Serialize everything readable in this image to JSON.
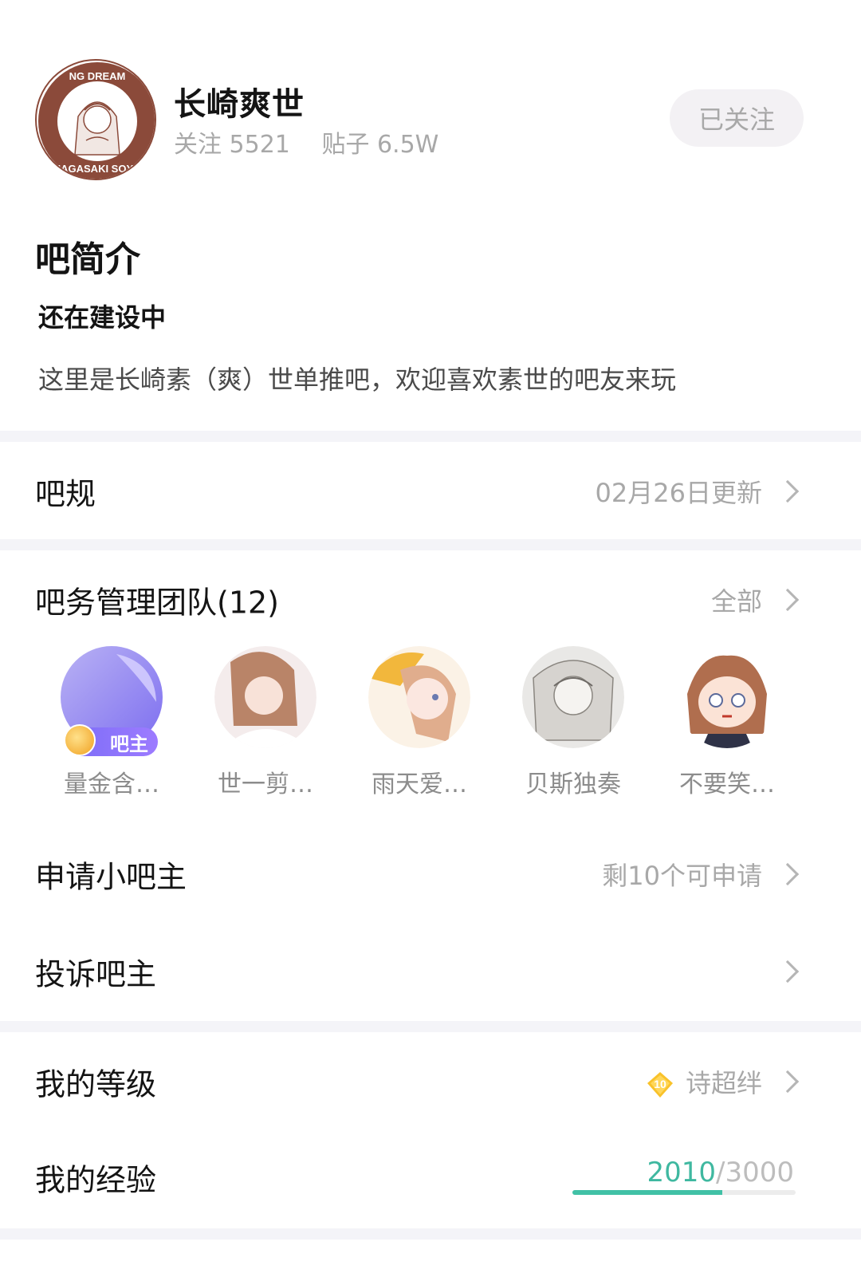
{
  "forum": {
    "name": "长崎爽世",
    "follow_count": "关注 5521",
    "post_count": "贴子 6.5W",
    "follow_button": "已关注",
    "avatar_text": "NAGASAKI SOYO · BANG DREAM"
  },
  "intro": {
    "title": "吧简介",
    "subtitle": "还在建设中",
    "text": "这里是长崎素（爽）世单推吧，欢迎喜欢素世的吧友来玩"
  },
  "rules": {
    "label": "吧规",
    "value": "02月26日更新"
  },
  "team": {
    "label": "吧务管理团队(12)",
    "value": "全部",
    "owner_badge": "吧主",
    "members": [
      {
        "name": "量金含…"
      },
      {
        "name": "世一剪…"
      },
      {
        "name": "雨天爱…"
      },
      {
        "name": "贝斯独奏"
      },
      {
        "name": "不要笑…"
      }
    ]
  },
  "apply": {
    "label": "申请小吧主",
    "value": "剩10个可申请"
  },
  "complain": {
    "label": "投诉吧主"
  },
  "level": {
    "label": "我的等级",
    "badge_number": "10",
    "title": "诗超绊"
  },
  "experience": {
    "label": "我的经验",
    "current": "2010",
    "separator": "/",
    "max": "3000",
    "progress_fraction": 0.67
  },
  "colors": {
    "accent": "#41c1a6",
    "muted_text": "#a8a8a8",
    "divider": "#f4f4f8"
  }
}
